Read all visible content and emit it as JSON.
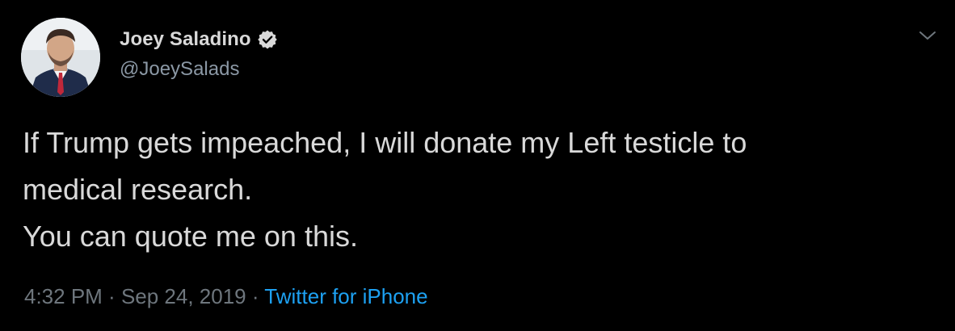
{
  "author": {
    "display_name": "Joey Saladino",
    "handle": "@JoeySalads",
    "verified": true
  },
  "tweet": {
    "lines": [
      "If Trump gets impeached, I will donate my Left testicle to",
      "medical research.",
      "You can quote me on this."
    ]
  },
  "meta": {
    "time": "4:32 PM",
    "separator1": " · ",
    "date": "Sep 24, 2019",
    "separator2": " · ",
    "source": "Twitter for iPhone"
  },
  "icons": {
    "verified": "verified-badge-icon",
    "menu": "chevron-down-icon"
  },
  "colors": {
    "background": "#000000",
    "text": "#d9d9d9",
    "secondary": "#6e767d",
    "link": "#1da1f2"
  }
}
